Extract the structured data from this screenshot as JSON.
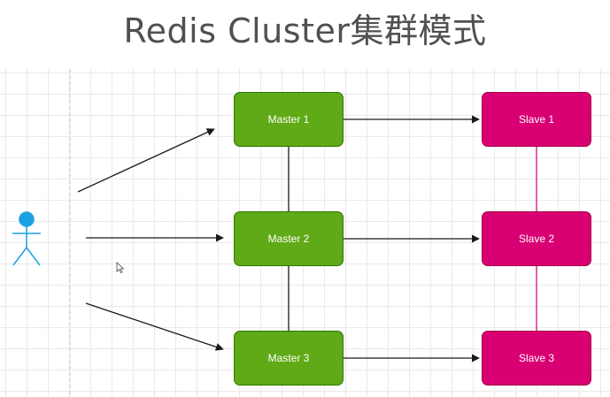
{
  "title": "Redis Cluster集群模式",
  "nodes": {
    "master1": "Master 1",
    "master2": "Master 2",
    "master3": "Master 3",
    "slave1": "Slave 1",
    "slave2": "Slave 2",
    "slave3": "Slave 3"
  },
  "colors": {
    "master_fill": "#60a917",
    "master_stroke": "#2d7600",
    "slave_fill": "#d80073",
    "slave_stroke": "#a50040",
    "actor": "#1ba1e2"
  },
  "icons": {
    "actor": "stick-figure-actor-icon",
    "cursor": "mouse-pointer-icon"
  }
}
